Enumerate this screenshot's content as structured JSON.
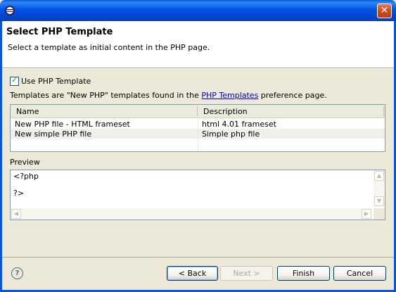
{
  "window": {
    "title": "",
    "close_label": "✕"
  },
  "header": {
    "title": "Select PHP Template",
    "description": "Select a template as initial content in the PHP page."
  },
  "use_template": {
    "label": "Use PHP Template",
    "checked": true
  },
  "info": {
    "prefix": "Templates are \"New PHP\" templates found in the ",
    "link": "PHP Templates",
    "suffix": " preference page."
  },
  "table": {
    "columns": [
      "Name",
      "Description"
    ],
    "rows": [
      {
        "name": "New PHP file - HTML frameset",
        "description": "html 4.01 frameset"
      },
      {
        "name": "New simple PHP file",
        "description": "Simple php file"
      }
    ]
  },
  "preview": {
    "label": "Preview",
    "lines": [
      "<?php",
      "",
      "?>"
    ]
  },
  "buttons": {
    "back": "< Back",
    "next": "Next >",
    "finish": "Finish",
    "cancel": "Cancel"
  },
  "colors": {
    "titlebar": "#0055e5",
    "link": "#0000c8",
    "close": "#d2471e"
  }
}
